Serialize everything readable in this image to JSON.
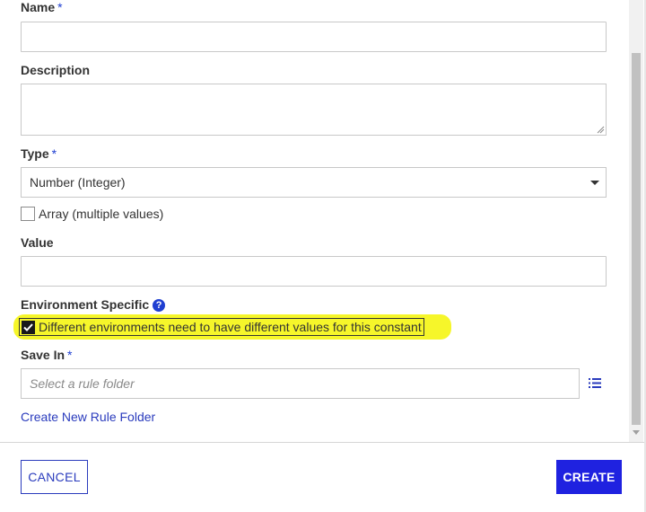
{
  "form": {
    "name": {
      "label": "Name",
      "required_mark": "*",
      "value": ""
    },
    "description": {
      "label": "Description",
      "value": ""
    },
    "type": {
      "label": "Type",
      "required_mark": "*",
      "selected": "Number (Integer)"
    },
    "array": {
      "label": "Array (multiple values)",
      "checked": false
    },
    "value": {
      "label": "Value",
      "value": ""
    },
    "environment": {
      "label": "Environment Specific",
      "help_glyph": "?",
      "checkbox_label": "Different environments need to have different values for this constant",
      "checked": true,
      "highlight_color": "#f6f62a"
    },
    "save_in": {
      "label": "Save In",
      "required_mark": "*",
      "placeholder": "Select a rule folder"
    },
    "create_folder_link": "Create New Rule Folder"
  },
  "footer": {
    "cancel_label": "CANCEL",
    "create_label": "CREATE"
  },
  "icons": {
    "help": "help-circle-icon",
    "folder_list": "list-icon",
    "dropdown": "caret-down-icon",
    "check": "checkmark-icon"
  },
  "colors": {
    "accent": "#1f3fd1",
    "primary_button": "#1f22e0",
    "link": "#2a3bbd"
  }
}
